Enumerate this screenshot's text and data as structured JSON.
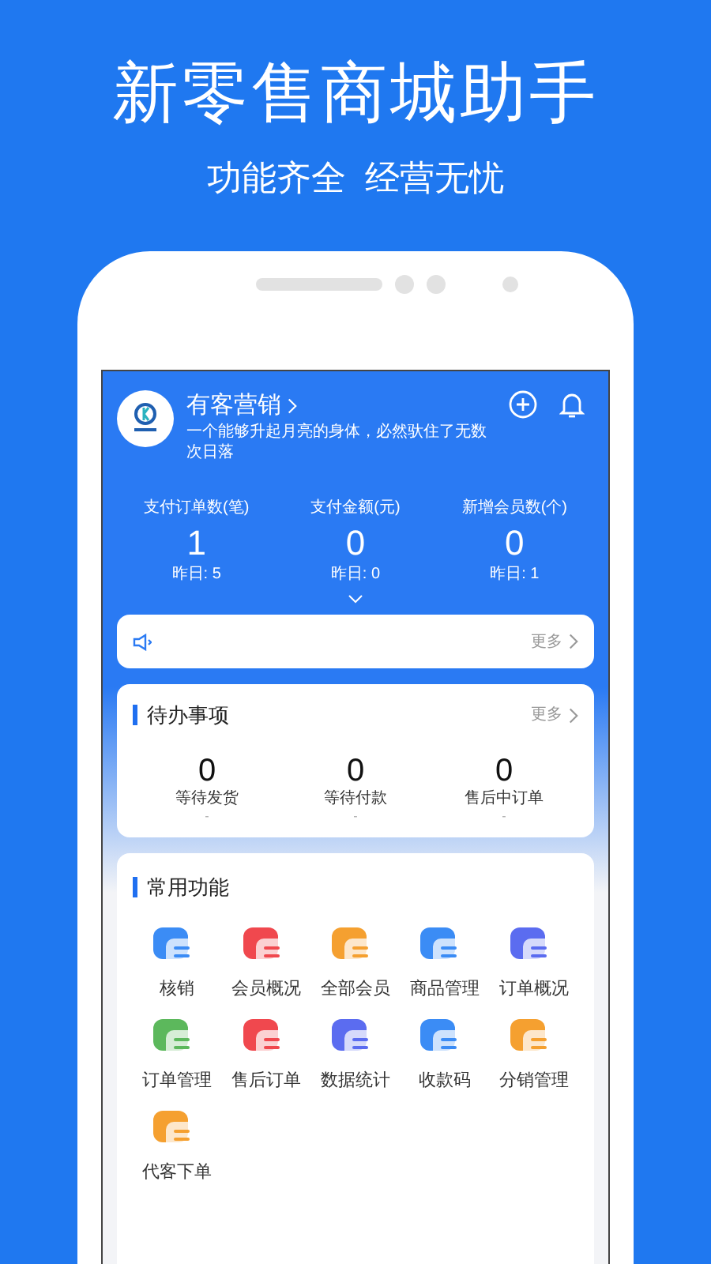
{
  "headline": "新零售商城助手",
  "tagline": "功能齐全  经营无忧",
  "store": {
    "name": "有客营销",
    "motto": "一个能够升起月亮的身体，必然驮住了无数次日落"
  },
  "stats": [
    {
      "label": "支付订单数(笔)",
      "value": "1",
      "yesterday": "昨日: 5"
    },
    {
      "label": "支付金额(元)",
      "value": "0",
      "yesterday": "昨日: 0"
    },
    {
      "label": "新增会员数(个)",
      "value": "0",
      "yesterday": "昨日: 1"
    }
  ],
  "notice": {
    "more": "更多"
  },
  "todo": {
    "title": "待办事项",
    "more": "更多",
    "items": [
      {
        "value": "0",
        "label": "等待发货",
        "note": "-"
      },
      {
        "value": "0",
        "label": "等待付款",
        "note": "-"
      },
      {
        "value": "0",
        "label": "售后中订单",
        "note": "-"
      }
    ]
  },
  "functions": {
    "title": "常用功能",
    "items": [
      {
        "label": "核销",
        "color": "#3b8cf5"
      },
      {
        "label": "会员概况",
        "color": "#f0484e"
      },
      {
        "label": "全部会员",
        "color": "#f5a030"
      },
      {
        "label": "商品管理",
        "color": "#3b8cf5"
      },
      {
        "label": "订单概况",
        "color": "#5b6cf0"
      },
      {
        "label": "订单管理",
        "color": "#5cb85c"
      },
      {
        "label": "售后订单",
        "color": "#f0484e"
      },
      {
        "label": "数据统计",
        "color": "#5b6cf0"
      },
      {
        "label": "收款码",
        "color": "#3b8cf5"
      },
      {
        "label": "分销管理",
        "color": "#f5a030"
      },
      {
        "label": "代客下单",
        "color": "#f5a030"
      }
    ]
  }
}
